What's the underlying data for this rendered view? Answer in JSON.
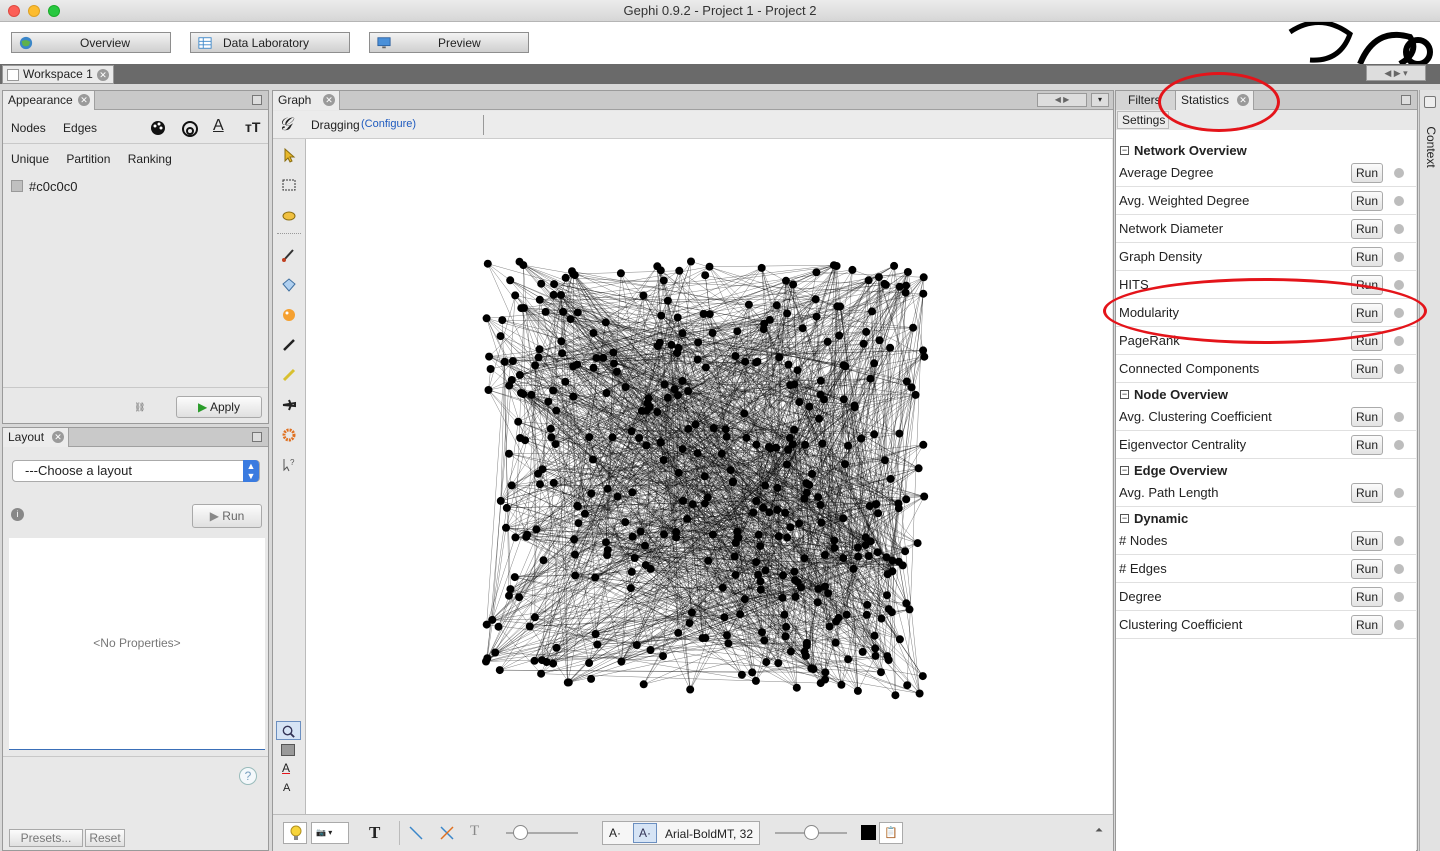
{
  "window": {
    "title": "Gephi 0.9.2 - Project 1 - Project 2"
  },
  "modes": [
    {
      "label": "Overview"
    },
    {
      "label": "Data Laboratory"
    },
    {
      "label": "Preview"
    }
  ],
  "workspace": {
    "tab": "Workspace 1"
  },
  "appearance": {
    "tab": "Appearance",
    "subtabs": [
      "Nodes",
      "Edges"
    ],
    "modes": [
      "Unique",
      "Partition",
      "Ranking"
    ],
    "color_value": "#c0c0c0",
    "apply_label": "Apply"
  },
  "layout": {
    "tab": "Layout",
    "choose": "---Choose a layout",
    "run_label": "Run",
    "no_props": "<No Properties>",
    "presets": "Presets...",
    "reset": "Reset"
  },
  "graph": {
    "tab": "Graph",
    "dragging": "Dragging",
    "configure": "(Configure)",
    "font_label": "Arial-BoldMT, 32"
  },
  "right": {
    "filters_tab": "Filters",
    "statistics_tab": "Statistics",
    "settings_label": "Settings",
    "context_label": "Context",
    "run_label": "Run",
    "sections": [
      {
        "name": "Network Overview",
        "items": [
          "Average Degree",
          "Avg. Weighted Degree",
          "Network Diameter",
          "Graph Density",
          "HITS",
          "Modularity",
          "PageRank",
          "Connected Components"
        ]
      },
      {
        "name": "Node Overview",
        "items": [
          "Avg. Clustering Coefficient",
          "Eigenvector Centrality"
        ]
      },
      {
        "name": "Edge Overview",
        "items": [
          "Avg. Path Length"
        ]
      },
      {
        "name": "Dynamic",
        "items": [
          "# Nodes",
          "# Edges",
          "Degree",
          "Clustering Coefficient"
        ]
      }
    ]
  },
  "colors": {
    "highlight": "#e4141a",
    "link": "#1f5bbf"
  }
}
